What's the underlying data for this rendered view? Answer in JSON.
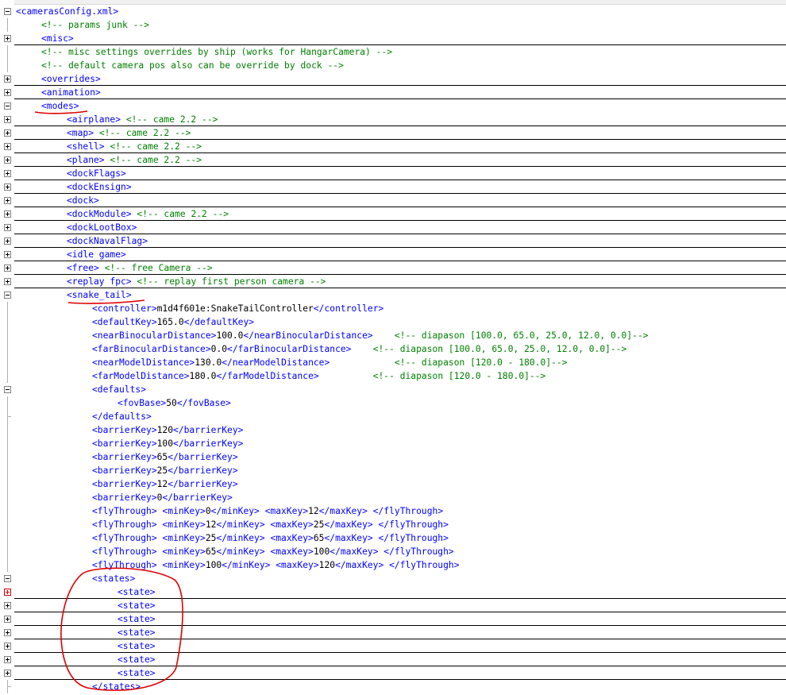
{
  "lines": [
    {
      "indent": 0,
      "fold": "open",
      "tail": "top",
      "ul": false,
      "parts": [
        {
          "t": "tag",
          "v": "<camerasConfig.xml>"
        }
      ]
    },
    {
      "indent": 1,
      "fold": null,
      "tail": false,
      "ul": false,
      "parts": [
        {
          "t": "cmt",
          "v": "<!-- params junk -->"
        }
      ]
    },
    {
      "indent": 1,
      "fold": "closed",
      "tail": false,
      "ul": true,
      "parts": [
        {
          "t": "tag",
          "v": "<misc>"
        }
      ]
    },
    {
      "indent": 1,
      "fold": null,
      "tail": false,
      "ul": false,
      "parts": [
        {
          "t": "cmt",
          "v": "<!-- misc settings overrides by ship (works for HangarCamera) -->"
        }
      ]
    },
    {
      "indent": 1,
      "fold": null,
      "tail": false,
      "ul": false,
      "parts": [
        {
          "t": "cmt",
          "v": "<!-- default camera pos also can be override by dock -->"
        }
      ]
    },
    {
      "indent": 1,
      "fold": "closed",
      "tail": false,
      "ul": true,
      "parts": [
        {
          "t": "tag",
          "v": "<overrides>"
        }
      ]
    },
    {
      "indent": 1,
      "fold": "closed",
      "tail": false,
      "ul": true,
      "parts": [
        {
          "t": "tag",
          "v": "<animation>"
        }
      ]
    },
    {
      "indent": 1,
      "fold": "open",
      "tail": false,
      "ul": false,
      "parts": [
        {
          "t": "tag",
          "v": "<modes>"
        }
      ]
    },
    {
      "indent": 2,
      "fold": "closed",
      "tail": false,
      "ul": true,
      "parts": [
        {
          "t": "tag",
          "v": "<airplane>"
        },
        {
          "t": "cmt",
          "v": " <!-- came 2.2 -->"
        }
      ]
    },
    {
      "indent": 2,
      "fold": "closed",
      "tail": false,
      "ul": true,
      "parts": [
        {
          "t": "tag",
          "v": "<map>"
        },
        {
          "t": "cmt",
          "v": " <!-- came 2.2 -->"
        }
      ]
    },
    {
      "indent": 2,
      "fold": "closed",
      "tail": false,
      "ul": true,
      "parts": [
        {
          "t": "tag",
          "v": "<shell>"
        },
        {
          "t": "cmt",
          "v": " <!-- came 2.2 -->"
        }
      ]
    },
    {
      "indent": 2,
      "fold": "closed",
      "tail": false,
      "ul": true,
      "parts": [
        {
          "t": "tag",
          "v": "<plane>"
        },
        {
          "t": "cmt",
          "v": " <!-- came 2.2 -->"
        }
      ]
    },
    {
      "indent": 2,
      "fold": "closed",
      "tail": false,
      "ul": true,
      "parts": [
        {
          "t": "tag",
          "v": "<dockFlags>"
        }
      ]
    },
    {
      "indent": 2,
      "fold": "closed",
      "tail": false,
      "ul": true,
      "parts": [
        {
          "t": "tag",
          "v": "<dockEnsign>"
        }
      ]
    },
    {
      "indent": 2,
      "fold": "closed",
      "tail": false,
      "ul": true,
      "parts": [
        {
          "t": "tag",
          "v": "<dock>"
        }
      ]
    },
    {
      "indent": 2,
      "fold": "closed",
      "tail": false,
      "ul": true,
      "parts": [
        {
          "t": "tag",
          "v": "<dockModule>"
        },
        {
          "t": "cmt",
          "v": " <!-- came 2.2 -->"
        }
      ]
    },
    {
      "indent": 2,
      "fold": "closed",
      "tail": false,
      "ul": true,
      "parts": [
        {
          "t": "tag",
          "v": "<dockLootBox>"
        }
      ]
    },
    {
      "indent": 2,
      "fold": "closed",
      "tail": false,
      "ul": true,
      "parts": [
        {
          "t": "tag",
          "v": "<dockNavalFlag>"
        }
      ]
    },
    {
      "indent": 2,
      "fold": "closed",
      "tail": false,
      "ul": true,
      "parts": [
        {
          "t": "tag",
          "v": "<idle game>"
        }
      ]
    },
    {
      "indent": 2,
      "fold": "closed",
      "tail": false,
      "ul": true,
      "parts": [
        {
          "t": "tag",
          "v": "<free>"
        },
        {
          "t": "cmt",
          "v": " <!-- free Camera -->"
        }
      ]
    },
    {
      "indent": 2,
      "fold": "closed",
      "tail": false,
      "ul": true,
      "parts": [
        {
          "t": "tag",
          "v": "<replay fpc>"
        },
        {
          "t": "cmt",
          "v": " <!-- replay first person camera -->"
        }
      ]
    },
    {
      "indent": 2,
      "fold": "open",
      "tail": false,
      "ul": false,
      "parts": [
        {
          "t": "tag",
          "v": "<snake_tail>"
        }
      ]
    },
    {
      "indent": 3,
      "fold": null,
      "tail": false,
      "ul": false,
      "parts": [
        {
          "t": "tag",
          "v": "<controller>"
        },
        {
          "t": "txt",
          "v": "m1d4f601e:SnakeTailController"
        },
        {
          "t": "tag",
          "v": "</controller>"
        }
      ]
    },
    {
      "indent": 3,
      "fold": null,
      "tail": false,
      "ul": false,
      "parts": [
        {
          "t": "tag",
          "v": "<defaultKey>"
        },
        {
          "t": "txt",
          "v": "165.0"
        },
        {
          "t": "tag",
          "v": "</defaultKey>"
        }
      ]
    },
    {
      "indent": 3,
      "fold": null,
      "tail": false,
      "ul": false,
      "parts": [
        {
          "t": "tag",
          "v": "<nearBinocularDistance>"
        },
        {
          "t": "txt",
          "v": "100.0"
        },
        {
          "t": "tag",
          "v": "</nearBinocularDistance>"
        },
        {
          "t": "cmt",
          "v": "    <!-- diapason [100.0, 65.0, 25.0, 12.0, 0.0]-->"
        }
      ]
    },
    {
      "indent": 3,
      "fold": null,
      "tail": false,
      "ul": false,
      "parts": [
        {
          "t": "tag",
          "v": "<farBinocularDistance>"
        },
        {
          "t": "txt",
          "v": "0.0"
        },
        {
          "t": "tag",
          "v": "</farBinocularDistance>"
        },
        {
          "t": "cmt",
          "v": "    <!-- diapason [100.0, 65.0, 25.0, 12.0, 0.0]-->"
        }
      ]
    },
    {
      "indent": 3,
      "fold": null,
      "tail": false,
      "ul": false,
      "parts": [
        {
          "t": "tag",
          "v": "<nearModelDistance>"
        },
        {
          "t": "txt",
          "v": "130.0"
        },
        {
          "t": "tag",
          "v": "</nearModelDistance>"
        },
        {
          "t": "cmt",
          "v": "            <!-- diapason [120.0 - 180.0]-->"
        }
      ]
    },
    {
      "indent": 3,
      "fold": null,
      "tail": false,
      "ul": false,
      "parts": [
        {
          "t": "tag",
          "v": "<farModelDistance>"
        },
        {
          "t": "txt",
          "v": "180.0"
        },
        {
          "t": "tag",
          "v": "</farModelDistance>"
        },
        {
          "t": "cmt",
          "v": "          <!-- diapason [120.0 - 180.0]-->"
        }
      ]
    },
    {
      "indent": 3,
      "fold": "open",
      "tail": false,
      "ul": false,
      "parts": [
        {
          "t": "tag",
          "v": "<defaults>"
        }
      ]
    },
    {
      "indent": 4,
      "fold": null,
      "tail": false,
      "ul": false,
      "parts": [
        {
          "t": "tag",
          "v": "<fovBase>"
        },
        {
          "t": "txt",
          "v": "50"
        },
        {
          "t": "tag",
          "v": "</fovBase>"
        }
      ]
    },
    {
      "indent": 3,
      "fold": null,
      "tail": "end",
      "ul": false,
      "parts": [
        {
          "t": "tag",
          "v": "</defaults>"
        }
      ]
    },
    {
      "indent": 3,
      "fold": null,
      "tail": false,
      "ul": false,
      "parts": [
        {
          "t": "tag",
          "v": "<barrierKey>"
        },
        {
          "t": "txt",
          "v": "120"
        },
        {
          "t": "tag",
          "v": "</barrierKey>"
        }
      ]
    },
    {
      "indent": 3,
      "fold": null,
      "tail": false,
      "ul": false,
      "parts": [
        {
          "t": "tag",
          "v": "<barrierKey>"
        },
        {
          "t": "txt",
          "v": "100"
        },
        {
          "t": "tag",
          "v": "</barrierKey>"
        }
      ]
    },
    {
      "indent": 3,
      "fold": null,
      "tail": false,
      "ul": false,
      "parts": [
        {
          "t": "tag",
          "v": "<barrierKey>"
        },
        {
          "t": "txt",
          "v": "65"
        },
        {
          "t": "tag",
          "v": "</barrierKey>"
        }
      ]
    },
    {
      "indent": 3,
      "fold": null,
      "tail": false,
      "ul": false,
      "parts": [
        {
          "t": "tag",
          "v": "<barrierKey>"
        },
        {
          "t": "txt",
          "v": "25"
        },
        {
          "t": "tag",
          "v": "</barrierKey>"
        }
      ]
    },
    {
      "indent": 3,
      "fold": null,
      "tail": false,
      "ul": false,
      "parts": [
        {
          "t": "tag",
          "v": "<barrierKey>"
        },
        {
          "t": "txt",
          "v": "12"
        },
        {
          "t": "tag",
          "v": "</barrierKey>"
        }
      ]
    },
    {
      "indent": 3,
      "fold": null,
      "tail": false,
      "ul": false,
      "parts": [
        {
          "t": "tag",
          "v": "<barrierKey>"
        },
        {
          "t": "txt",
          "v": "0"
        },
        {
          "t": "tag",
          "v": "</barrierKey>"
        }
      ]
    },
    {
      "indent": 3,
      "fold": null,
      "tail": false,
      "ul": false,
      "parts": [
        {
          "t": "tag",
          "v": "<flyThrough> <minKey>"
        },
        {
          "t": "txt",
          "v": "0"
        },
        {
          "t": "tag",
          "v": "</minKey> <maxKey>"
        },
        {
          "t": "txt",
          "v": "12"
        },
        {
          "t": "tag",
          "v": "</maxKey> </flyThrough>"
        }
      ]
    },
    {
      "indent": 3,
      "fold": null,
      "tail": false,
      "ul": false,
      "parts": [
        {
          "t": "tag",
          "v": "<flyThrough> <minKey>"
        },
        {
          "t": "txt",
          "v": "12"
        },
        {
          "t": "tag",
          "v": "</minKey> <maxKey>"
        },
        {
          "t": "txt",
          "v": "25"
        },
        {
          "t": "tag",
          "v": "</maxKey> </flyThrough>"
        }
      ]
    },
    {
      "indent": 3,
      "fold": null,
      "tail": false,
      "ul": false,
      "parts": [
        {
          "t": "tag",
          "v": "<flyThrough> <minKey>"
        },
        {
          "t": "txt",
          "v": "25"
        },
        {
          "t": "tag",
          "v": "</minKey> <maxKey>"
        },
        {
          "t": "txt",
          "v": "65"
        },
        {
          "t": "tag",
          "v": "</maxKey> </flyThrough>"
        }
      ]
    },
    {
      "indent": 3,
      "fold": null,
      "tail": false,
      "ul": false,
      "parts": [
        {
          "t": "tag",
          "v": "<flyThrough> <minKey>"
        },
        {
          "t": "txt",
          "v": "65"
        },
        {
          "t": "tag",
          "v": "</minKey> <maxKey>"
        },
        {
          "t": "txt",
          "v": "100"
        },
        {
          "t": "tag",
          "v": "</maxKey> </flyThrough>"
        }
      ]
    },
    {
      "indent": 3,
      "fold": null,
      "tail": false,
      "ul": false,
      "parts": [
        {
          "t": "tag",
          "v": "<flyThrough> <minKey>"
        },
        {
          "t": "txt",
          "v": "100"
        },
        {
          "t": "tag",
          "v": "</minKey> <maxKey>"
        },
        {
          "t": "txt",
          "v": "120"
        },
        {
          "t": "tag",
          "v": "</maxKey> </flyThrough>"
        }
      ]
    },
    {
      "indent": 3,
      "fold": "open",
      "tail": false,
      "ul": false,
      "parts": [
        {
          "t": "tag",
          "v": "<states>"
        }
      ]
    },
    {
      "indent": 4,
      "fold": "closed-red",
      "tail": false,
      "ul": true,
      "parts": [
        {
          "t": "tag",
          "v": "<state>"
        }
      ]
    },
    {
      "indent": 4,
      "fold": "closed",
      "tail": false,
      "ul": true,
      "parts": [
        {
          "t": "tag",
          "v": "<state>"
        }
      ]
    },
    {
      "indent": 4,
      "fold": "closed",
      "tail": false,
      "ul": true,
      "parts": [
        {
          "t": "tag",
          "v": "<state>"
        }
      ]
    },
    {
      "indent": 4,
      "fold": "closed",
      "tail": false,
      "ul": true,
      "parts": [
        {
          "t": "tag",
          "v": "<state>"
        }
      ]
    },
    {
      "indent": 4,
      "fold": "closed",
      "tail": false,
      "ul": true,
      "parts": [
        {
          "t": "tag",
          "v": "<state>"
        }
      ]
    },
    {
      "indent": 4,
      "fold": "closed",
      "tail": false,
      "ul": true,
      "parts": [
        {
          "t": "tag",
          "v": "<state>"
        }
      ]
    },
    {
      "indent": 4,
      "fold": "closed",
      "tail": false,
      "ul": true,
      "parts": [
        {
          "t": "tag",
          "v": "<state>"
        }
      ]
    },
    {
      "indent": 3,
      "fold": null,
      "tail": "end",
      "ul": false,
      "parts": [
        {
          "t": "tag",
          "v": "</states>"
        }
      ]
    }
  ],
  "colors": {
    "tag": "#0000ff",
    "text": "#000000",
    "comment": "#008000",
    "annotation": "#e00000",
    "fold_border": "#808080",
    "underline": "#000000"
  },
  "icons": {
    "fold_open": "minus-box-icon",
    "fold_closed": "plus-box-icon"
  }
}
